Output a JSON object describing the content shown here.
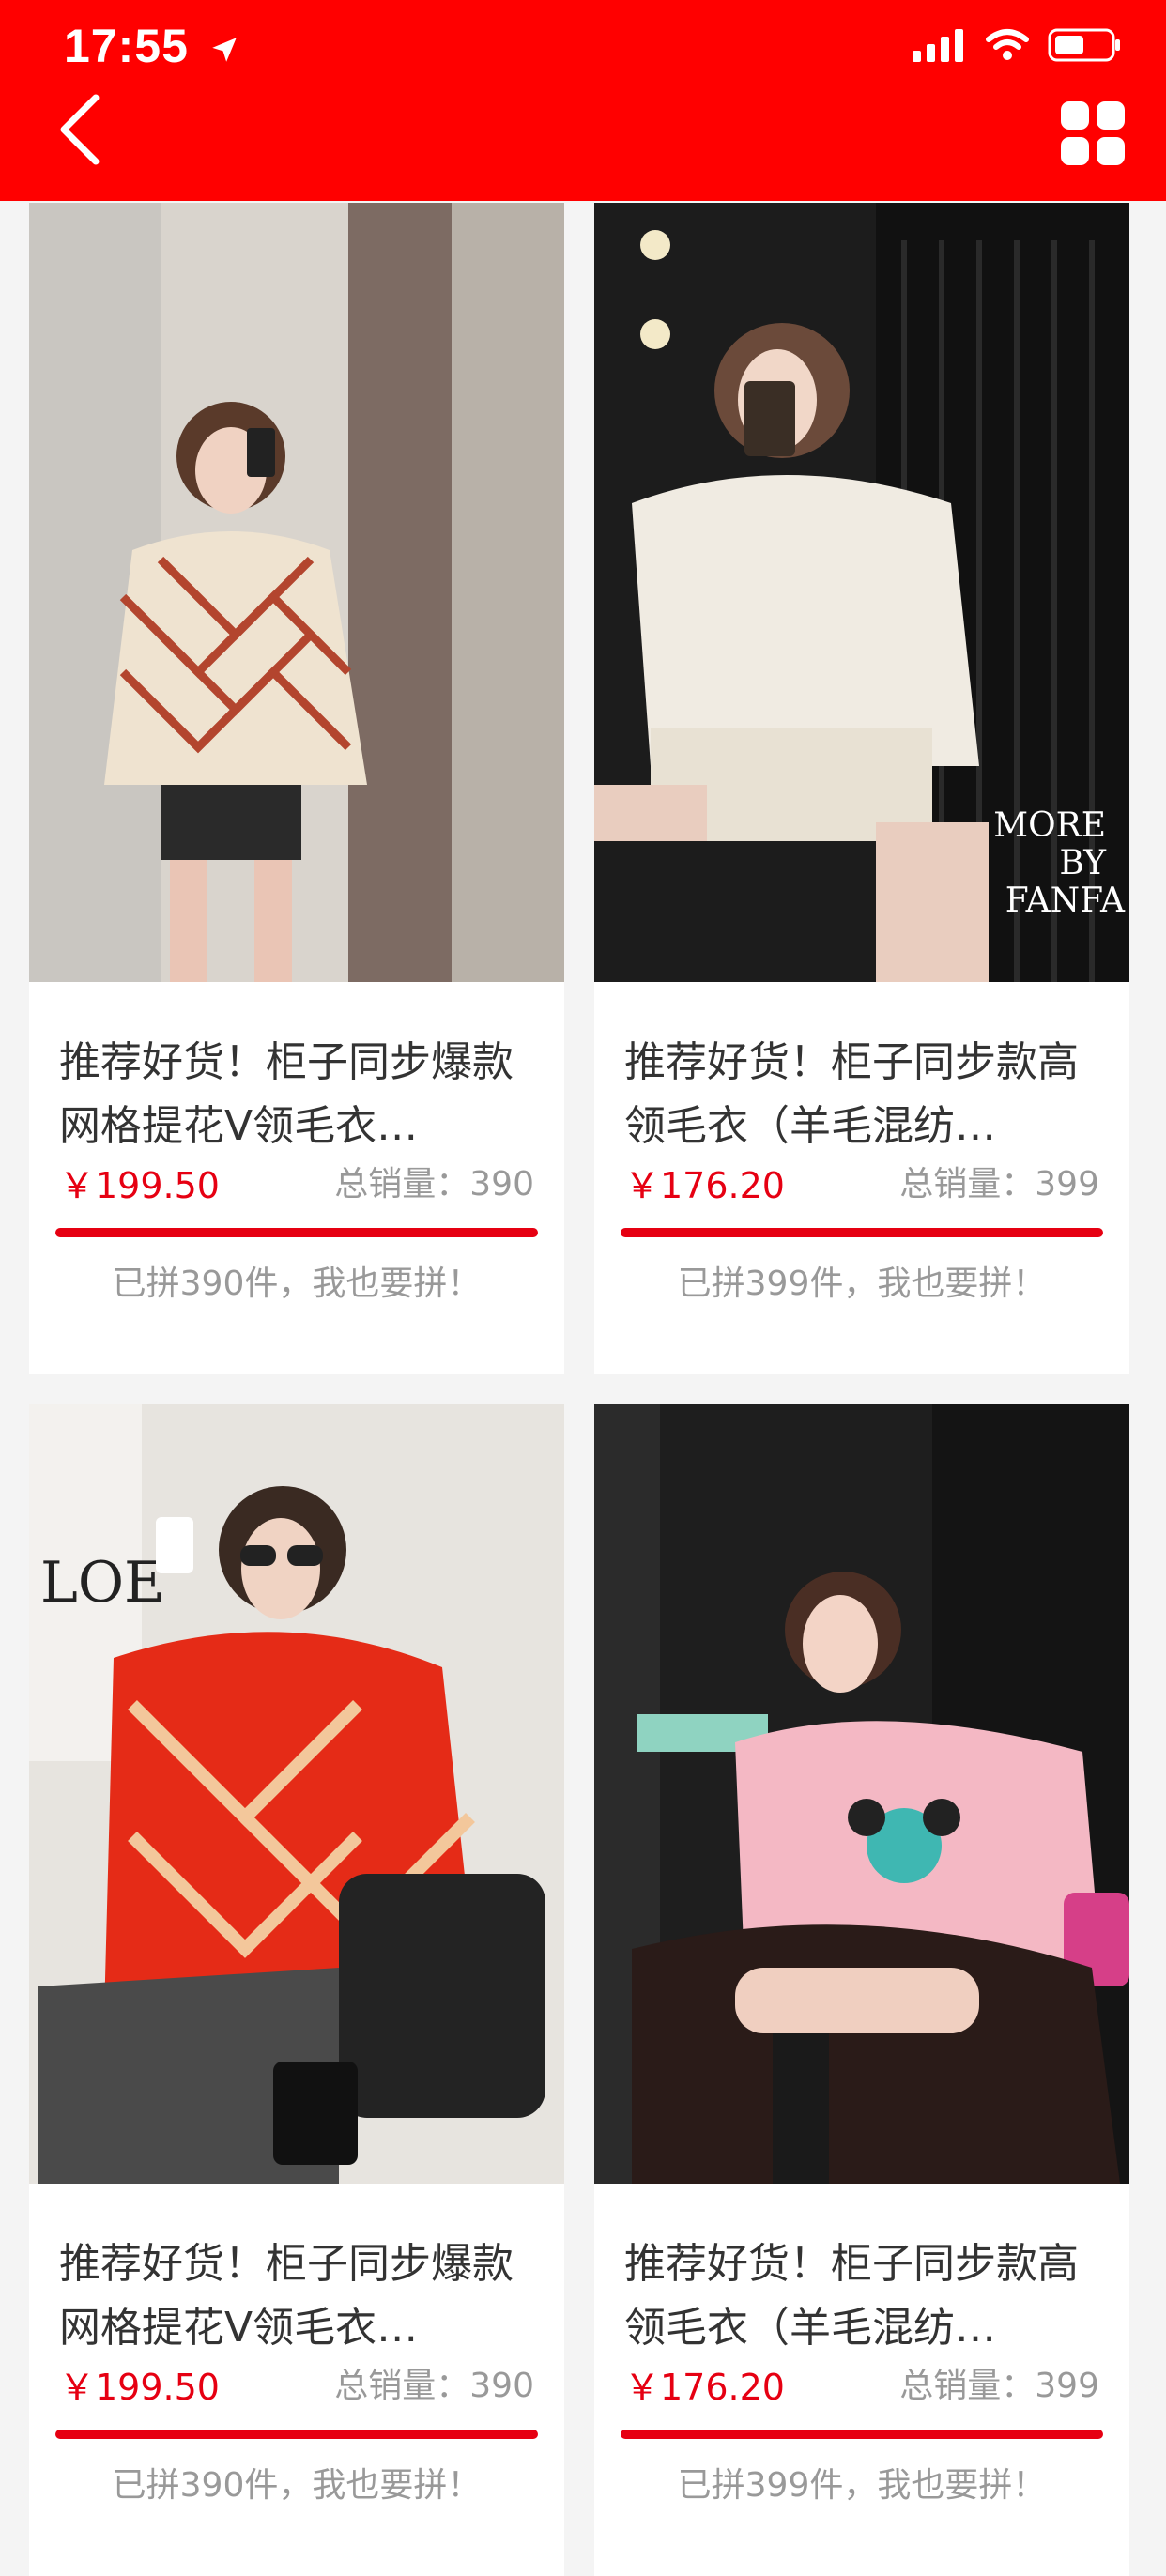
{
  "status_bar": {
    "time": "17:55"
  },
  "header": {
    "back_icon": "chevron-left-icon",
    "menu_icon": "grid-icon",
    "color": "#ff0000"
  },
  "products": [
    {
      "title": "推荐好货！柜子同步爆款网格提花V领毛衣…",
      "price": "￥199.50",
      "sales": "总销量：390",
      "joined": "已拼390件，我也要拼！"
    },
    {
      "title": "推荐好货！柜子同步款高领毛衣（羊毛混纺…",
      "price": "￥176.20",
      "sales": "总销量：399",
      "joined": "已拼399件，我也要拼！",
      "image_text": "MORE BY FANFA"
    },
    {
      "title": "推荐好货！柜子同步爆款网格提花V领毛衣…",
      "price": "￥199.50",
      "sales": "总销量：390",
      "joined": "已拼390件，我也要拼！"
    },
    {
      "title": "推荐好货！柜子同步款高领毛衣（羊毛混纺…",
      "price": "￥176.20",
      "sales": "总销量：399",
      "joined": "已拼399件，我也要拼！"
    }
  ],
  "colors": {
    "accent": "#e60012",
    "muted": "#999999"
  }
}
